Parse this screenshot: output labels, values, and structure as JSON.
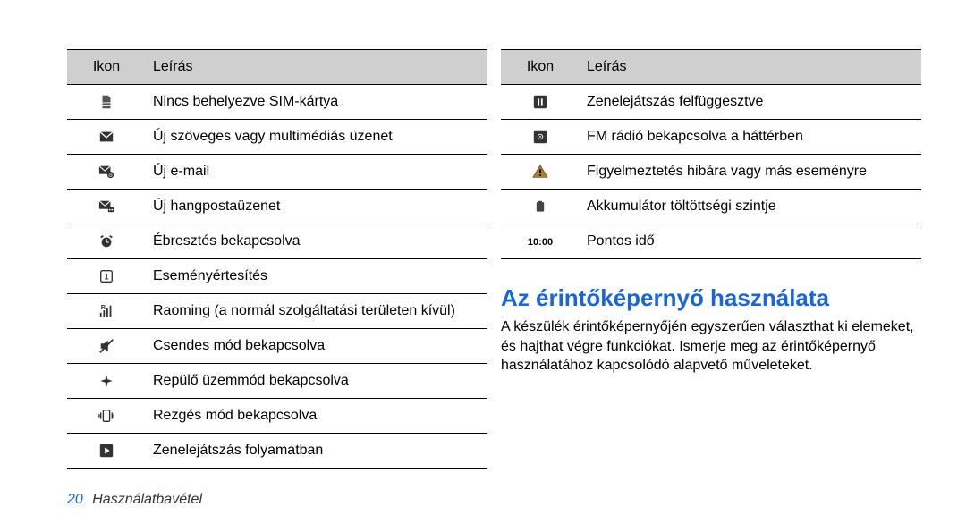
{
  "left_table": {
    "head_icon": "Ikon",
    "head_desc": "Leírás",
    "rows": [
      {
        "icon": "sim",
        "desc": "Nincs behelyezve SIM-kártya"
      },
      {
        "icon": "sms",
        "desc": "Új szöveges vagy multimédiás üzenet"
      },
      {
        "icon": "email",
        "desc": "Új e-mail"
      },
      {
        "icon": "vmail",
        "desc": "Új hangpostaüzenet"
      },
      {
        "icon": "alarm",
        "desc": "Ébresztés bekapcsolva"
      },
      {
        "icon": "event",
        "desc": "Eseményértesítés"
      },
      {
        "icon": "roaming",
        "desc": "Raoming (a normál szolgáltatási területen kívül)"
      },
      {
        "icon": "silent",
        "desc": "Csendes mód bekapcsolva"
      },
      {
        "icon": "flight",
        "desc": "Repülő üzemmód bekapcsolva"
      },
      {
        "icon": "vibrate",
        "desc": "Rezgés mód bekapcsolva"
      },
      {
        "icon": "play",
        "desc": "Zenelejátszás folyamatban"
      }
    ]
  },
  "right_table": {
    "head_icon": "Ikon",
    "head_desc": "Leírás",
    "rows": [
      {
        "icon": "pause",
        "desc": "Zenelejátszás felfüggesztve"
      },
      {
        "icon": "radio",
        "desc": "FM rádió bekapcsolva a háttérben"
      },
      {
        "icon": "warn",
        "desc": "Figyelmeztetés hibára vagy más eseményre"
      },
      {
        "icon": "battery",
        "desc": "Akkumulátor töltöttségi szintje"
      },
      {
        "icon": "time",
        "desc": "Pontos idő",
        "icon_text": "10:00"
      }
    ]
  },
  "section_title": "Az érintőképernyő használata",
  "section_body": "A készülék érintőképernyőjén egyszerűen választhat ki elemeket, és hajthat végre funkciókat. Ismerje meg az érintőképernyő használatához kapcsolódó alapvető műveleteket.",
  "footer": {
    "page": "20",
    "section": "Használatbavétel"
  }
}
